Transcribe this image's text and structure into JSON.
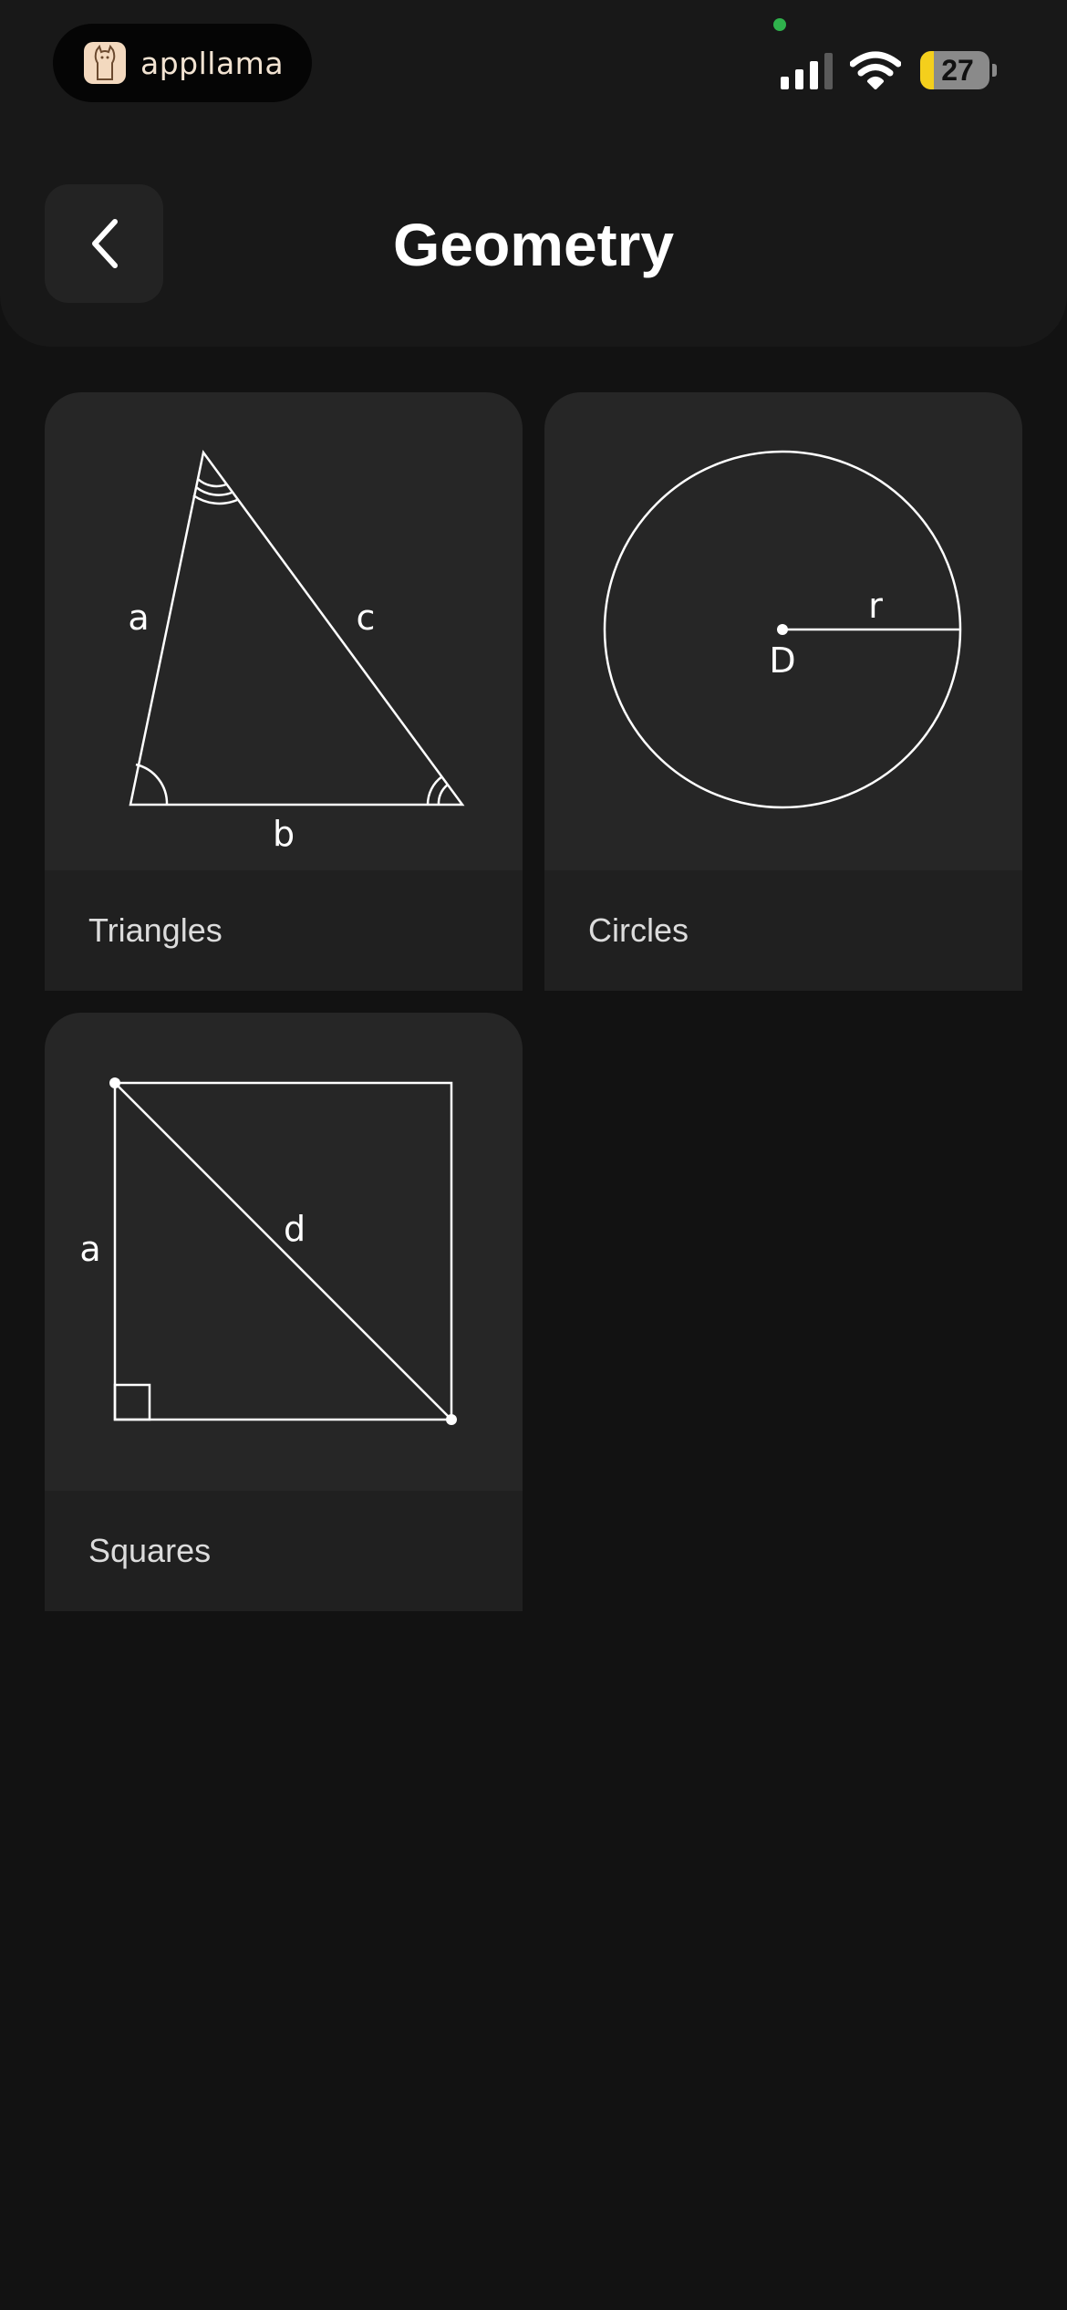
{
  "status_bar": {
    "app_name": "appllama",
    "battery_level": "27",
    "battery_fraction": 0.2,
    "colors": {
      "camera_dot": "#2fb24c",
      "battery_fill": "#f4cf1c"
    }
  },
  "header": {
    "title": "Geometry",
    "back_icon": "chevron-left-icon"
  },
  "cards": [
    {
      "label": "Triangles",
      "shape": "triangle",
      "side_labels": [
        "a",
        "b",
        "c"
      ]
    },
    {
      "label": "Circles",
      "shape": "circle",
      "center_label": "D",
      "radius_label": "r"
    },
    {
      "label": "Squares",
      "shape": "square",
      "side_label": "a",
      "diagonal_label": "d"
    }
  ]
}
